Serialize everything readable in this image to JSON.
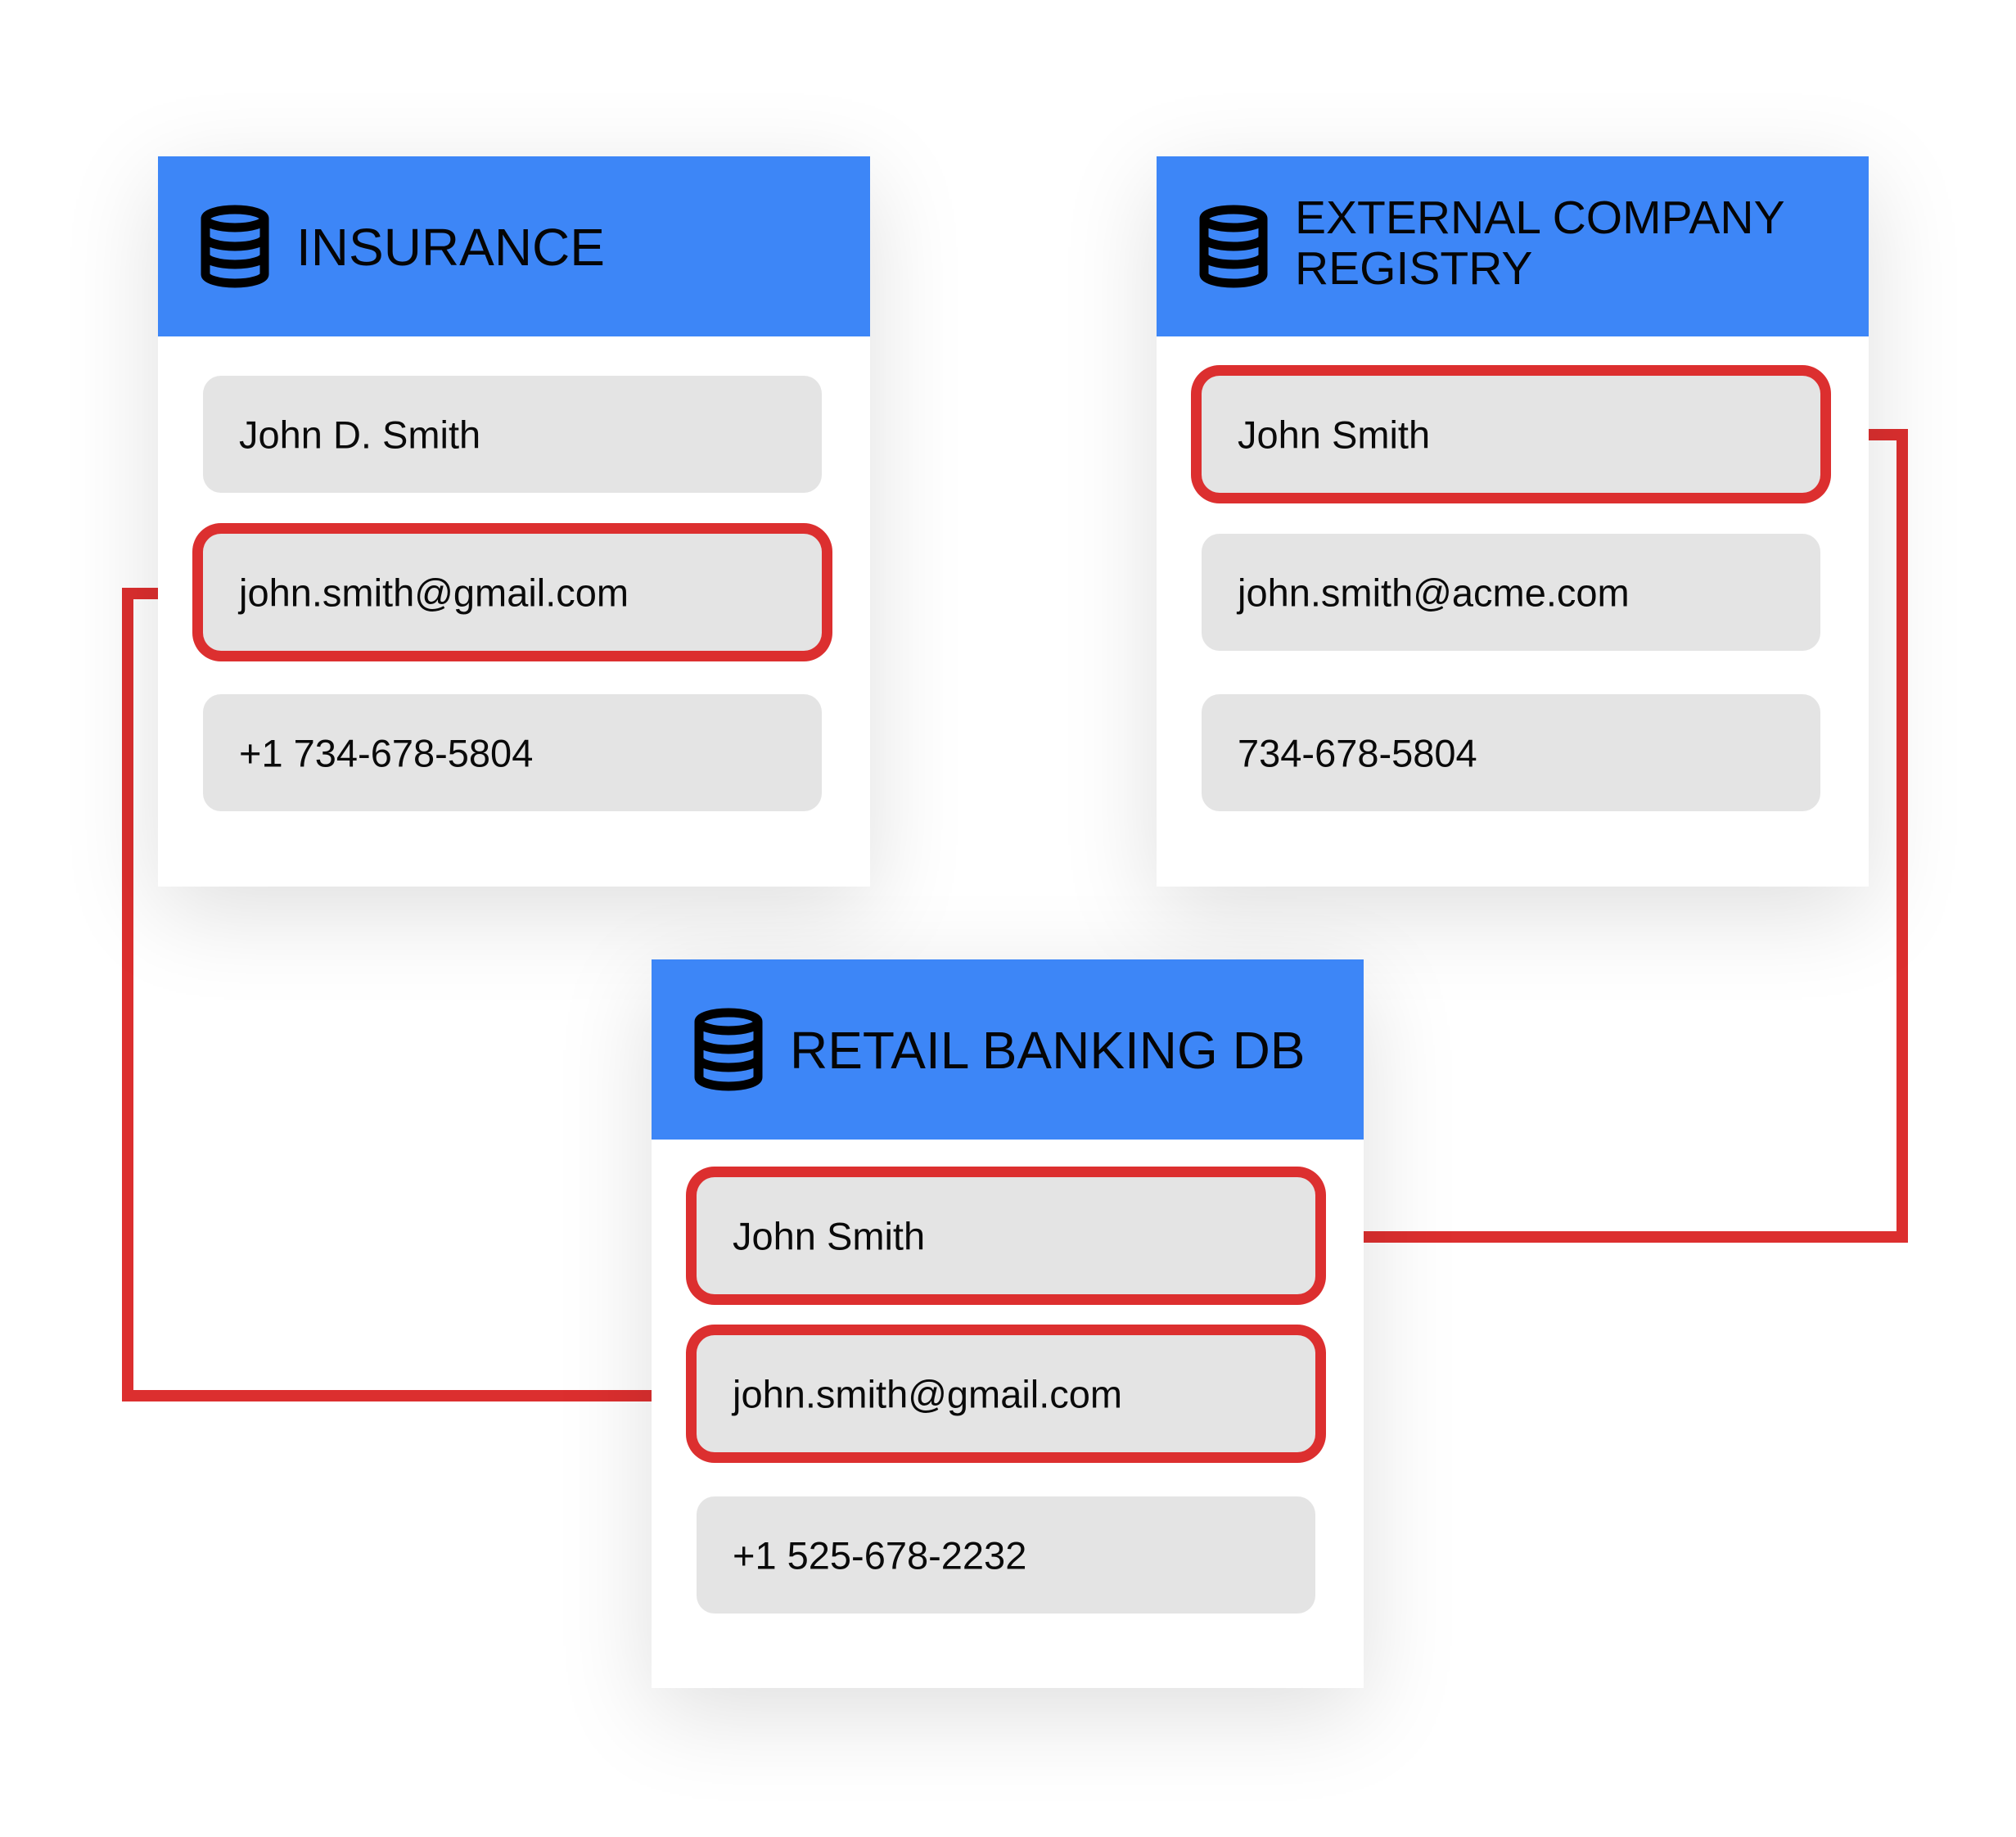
{
  "colors": {
    "header": "#3d86f7",
    "highlight": "#dc2f2f",
    "field": "#e4e4e4"
  },
  "icons": {
    "database": "database-icon"
  },
  "cards": {
    "insurance": {
      "title": "INSURANCE",
      "fields": [
        "John D. Smith",
        "john.smith@gmail.com",
        "+1 734-678-5804"
      ],
      "highlighted": [
        1
      ]
    },
    "external": {
      "title_line1": "EXTERNAL COMPANY",
      "title_line2": "REGISTRY",
      "fields": [
        "John Smith",
        "john.smith@acme.com",
        "734-678-5804"
      ],
      "highlighted": [
        0
      ]
    },
    "retail": {
      "title": "RETAIL BANKING DB",
      "fields": [
        "John Smith",
        "john.smith@gmail.com",
        "+1 525-678-2232"
      ],
      "highlighted": [
        0,
        1
      ]
    }
  },
  "links": [
    {
      "from": "insurance.email",
      "to": "retail.email"
    },
    {
      "from": "external.name",
      "to": "retail.name"
    }
  ]
}
